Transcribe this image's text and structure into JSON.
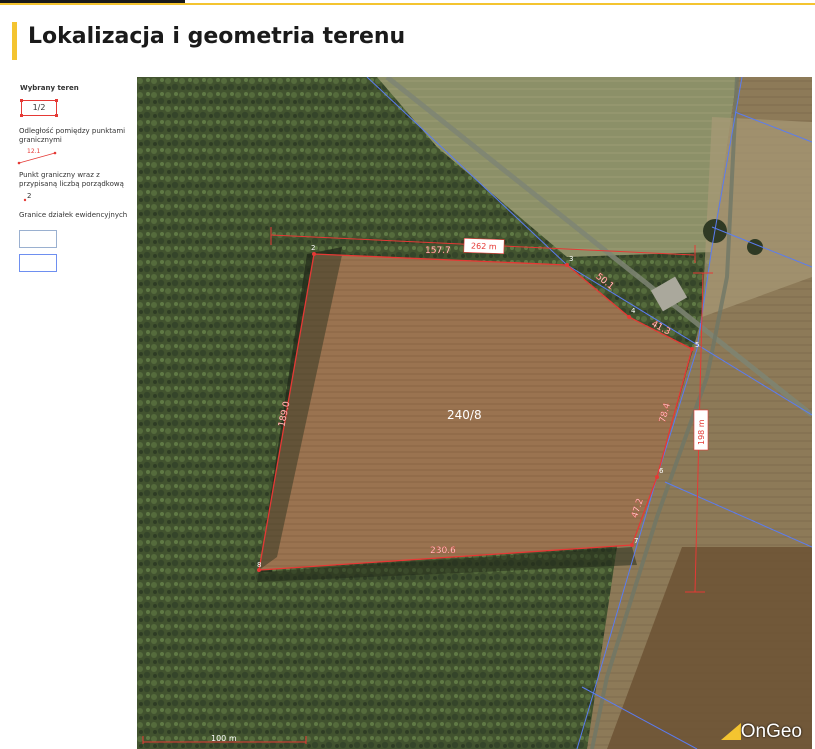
{
  "page": {
    "title": "Lokalizacja i geometria terenu"
  },
  "legend": {
    "selected_label": "Wybrany teren",
    "selected_value": "1/2",
    "distance_label": "Odległość pomiędzy punktami granicznymi",
    "distance_sample": "12.1",
    "point_label": "Punkt graniczny wraz z przypisaną liczbą porządkową",
    "point_sample": "2",
    "parcels_label": "Granice działek ewidencyjnych"
  },
  "map": {
    "parcel_id": "240/8",
    "edges": [
      "157.7",
      "50.1",
      "41.3",
      "78.4",
      "47.2",
      "230.6",
      "189.0"
    ],
    "point_numbers": [
      "2",
      "3",
      "4",
      "5",
      "6",
      "7",
      "8"
    ],
    "dim_horizontal": "262 m",
    "dim_vertical": "198 m",
    "scale_label": "100 m",
    "logo": "OnGeo",
    "colors": {
      "boundary": "#e53935",
      "parcels": "#5b7cf0",
      "accent": "#f4c430"
    }
  }
}
